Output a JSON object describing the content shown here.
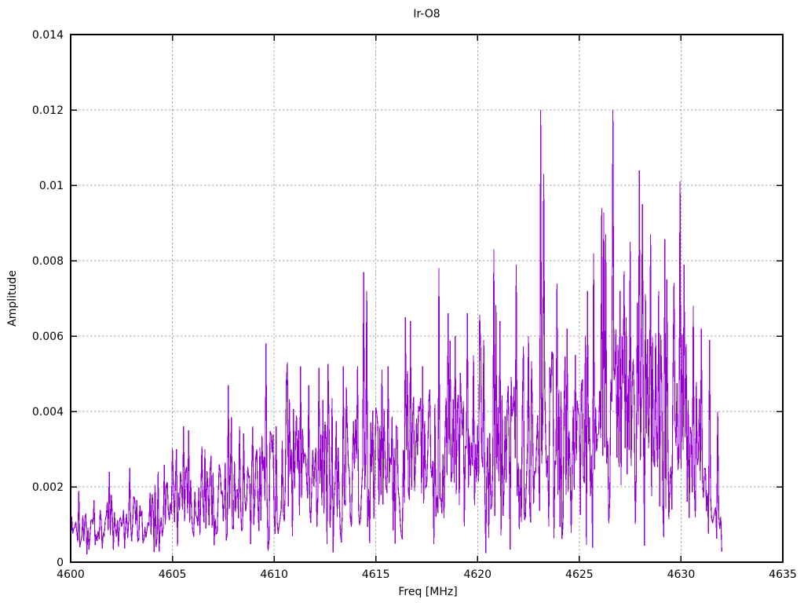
{
  "chart_data": {
    "type": "line",
    "title": "Ir-O8",
    "xlabel": "Freq [MHz]",
    "ylabel": "Amplitude",
    "xlim": [
      4600,
      4635
    ],
    "ylim": [
      0,
      0.014
    ],
    "xticks": [
      4600,
      4605,
      4610,
      4615,
      4620,
      4625,
      4630,
      4635
    ],
    "yticks": [
      0,
      0.002,
      0.004,
      0.006,
      0.008,
      0.01,
      0.012,
      0.014
    ],
    "ytick_labels": [
      "0",
      "0.002",
      "0.004",
      "0.006",
      "0.008",
      "0.01",
      "0.012",
      "0.014"
    ],
    "grid": {
      "show": true,
      "style": "dashed",
      "color": "#a6a6a6"
    },
    "legend_position": "none",
    "line_color": "#9400d3",
    "axis_color": "#000000",
    "series": [
      {
        "name": "Ir-O8",
        "x_start": 4600,
        "x_end": 4632,
        "x_step": 0.05,
        "noise_seed": 1337,
        "envelope_mid": [
          [
            4600,
            0.0008
          ],
          [
            4601,
            0.001
          ],
          [
            4602,
            0.0011
          ],
          [
            4603,
            0.0011
          ],
          [
            4604,
            0.0013
          ],
          [
            4605,
            0.0015
          ],
          [
            4606,
            0.0016
          ],
          [
            4607,
            0.0017
          ],
          [
            4608,
            0.0019
          ],
          [
            4609,
            0.002
          ],
          [
            4610,
            0.0022
          ],
          [
            4611,
            0.0024
          ],
          [
            4612,
            0.0022
          ],
          [
            4613,
            0.0023
          ],
          [
            4614,
            0.0024
          ],
          [
            4615,
            0.0026
          ],
          [
            4616,
            0.0026
          ],
          [
            4617,
            0.0026
          ],
          [
            4618,
            0.0028
          ],
          [
            4619,
            0.0027
          ],
          [
            4620,
            0.0028
          ],
          [
            4621,
            0.0029
          ],
          [
            4622,
            0.003
          ],
          [
            4623,
            0.0032
          ],
          [
            4624,
            0.0033
          ],
          [
            4625,
            0.0035
          ],
          [
            4626,
            0.0038
          ],
          [
            4627,
            0.0038
          ],
          [
            4628,
            0.0038
          ],
          [
            4629,
            0.0037
          ],
          [
            4630,
            0.0036
          ],
          [
            4631,
            0.003
          ],
          [
            4631.5,
            0.0024
          ],
          [
            4632,
            0.0016
          ]
        ],
        "envelope_spread": [
          [
            4600,
            0.0006
          ],
          [
            4602,
            0.0007
          ],
          [
            4604,
            0.0008
          ],
          [
            4606,
            0.001
          ],
          [
            4608,
            0.0012
          ],
          [
            4610,
            0.0014
          ],
          [
            4612,
            0.0015
          ],
          [
            4614,
            0.0016
          ],
          [
            4616,
            0.0017
          ],
          [
            4618,
            0.0018
          ],
          [
            4620,
            0.0019
          ],
          [
            4622,
            0.0021
          ],
          [
            4624,
            0.0023
          ],
          [
            4626,
            0.0026
          ],
          [
            4628,
            0.0027
          ],
          [
            4629,
            0.0027
          ],
          [
            4630,
            0.0026
          ],
          [
            4631,
            0.0018
          ],
          [
            4632,
            0.001
          ]
        ],
        "peaks": [
          [
            4601.9,
            0.0024
          ],
          [
            4602.9,
            0.0025
          ],
          [
            4605.55,
            0.0036
          ],
          [
            4605.8,
            0.0035
          ],
          [
            4606.6,
            0.003
          ],
          [
            4607.75,
            0.0047
          ],
          [
            4608.3,
            0.0036
          ],
          [
            4609.6,
            0.0058
          ],
          [
            4610.1,
            0.0036
          ],
          [
            4611.3,
            0.0052
          ],
          [
            4611.7,
            0.0047
          ],
          [
            4612.4,
            0.0043
          ],
          [
            4613.4,
            0.0052
          ],
          [
            4614.4,
            0.0077
          ],
          [
            4614.55,
            0.0072
          ],
          [
            4615.3,
            0.0051
          ],
          [
            4615.6,
            0.0052
          ],
          [
            4616.45,
            0.0065
          ],
          [
            4616.7,
            0.0064
          ],
          [
            4617.3,
            0.0052
          ],
          [
            4618.1,
            0.0078
          ],
          [
            4618.55,
            0.0066
          ],
          [
            4618.9,
            0.006
          ],
          [
            4619.5,
            0.0066
          ],
          [
            4620.3,
            0.0059
          ],
          [
            4620.8,
            0.0083
          ],
          [
            4621.1,
            0.0064
          ],
          [
            4621.9,
            0.0079
          ],
          [
            4622.5,
            0.006
          ],
          [
            4623.1,
            0.012
          ],
          [
            4623.25,
            0.0103
          ],
          [
            4623.9,
            0.0074
          ],
          [
            4624.4,
            0.0062
          ],
          [
            4624.8,
            0.0055
          ],
          [
            4625.3,
            0.006
          ],
          [
            4625.7,
            0.0082
          ],
          [
            4626.1,
            0.0094
          ],
          [
            4626.3,
            0.0087
          ],
          [
            4626.65,
            0.012
          ],
          [
            4627.0,
            0.0072
          ],
          [
            4627.5,
            0.0085
          ],
          [
            4627.95,
            0.0104
          ],
          [
            4628.1,
            0.0095
          ],
          [
            4628.5,
            0.0087
          ],
          [
            4628.9,
            0.0072
          ],
          [
            4629.3,
            0.0075
          ],
          [
            4629.95,
            0.0101
          ],
          [
            4630.15,
            0.0079
          ],
          [
            4630.6,
            0.0068
          ],
          [
            4631.0,
            0.0062
          ],
          [
            4631.4,
            0.0059
          ],
          [
            4631.8,
            0.004
          ]
        ]
      }
    ]
  }
}
